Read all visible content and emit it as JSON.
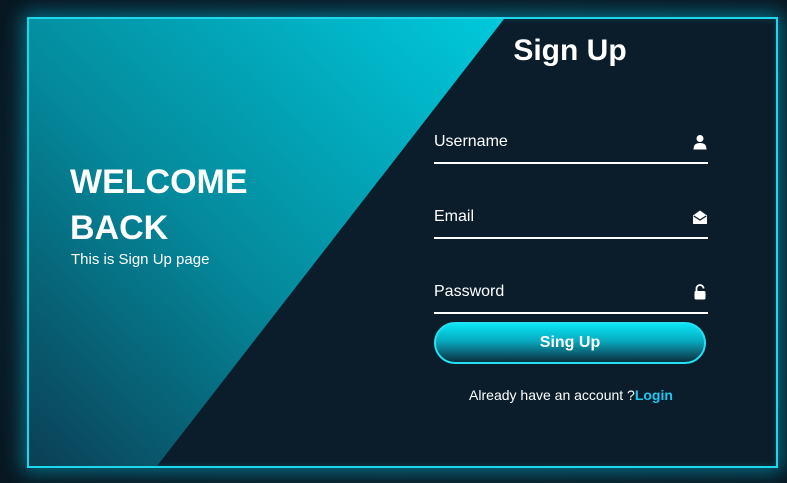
{
  "welcome": {
    "line1": "WELCOME",
    "line2": "BACK",
    "subtitle": "This is Sign Up page"
  },
  "form": {
    "title": "Sign Up",
    "fields": [
      {
        "placeholder": "Username",
        "icon": "user-icon"
      },
      {
        "placeholder": "Email",
        "icon": "envelope-open-icon"
      },
      {
        "placeholder": "Password",
        "icon": "lock-icon"
      }
    ],
    "submit_label": "Sing Up",
    "footer_text": "Already have an account ?",
    "footer_link": "Login"
  },
  "colors": {
    "accent": "#1fd7ea",
    "panel_dark": "#0b1d2a",
    "link": "#1fc6f0"
  }
}
